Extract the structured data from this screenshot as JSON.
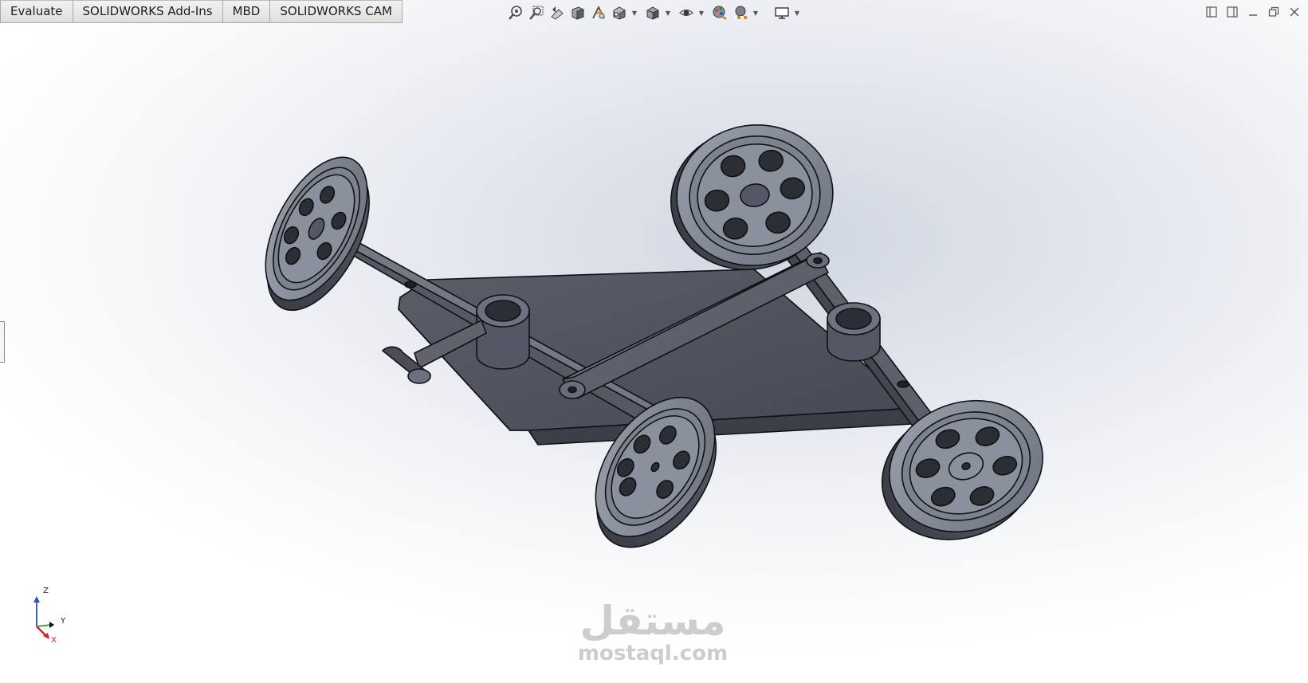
{
  "command_manager": {
    "tabs": [
      {
        "label": "Evaluate"
      },
      {
        "label": "SOLIDWORKS Add-Ins"
      },
      {
        "label": "MBD"
      },
      {
        "label": "SOLIDWORKS CAM"
      }
    ]
  },
  "heads_up_toolbar": {
    "icons": [
      "zoom-to-fit-icon",
      "zoom-to-area-icon",
      "previous-view-icon",
      "section-view-icon",
      "dynamic-annotation-icon",
      "view-orientation-icon",
      "display-style-icon",
      "hide-show-items-icon",
      "edit-appearance-icon",
      "apply-scene-icon",
      "view-settings-icon"
    ]
  },
  "triad": {
    "z_label": "Z",
    "y_label": "Y",
    "x_label": "X",
    "colors": {
      "z": "#2a4fd6",
      "y": "#2e9c3a",
      "x": "#d42020"
    }
  },
  "watermark": {
    "arabic": "مستقل",
    "latin": "mostaql.com"
  },
  "colors": {
    "part_face": "#4f525d",
    "part_light": "#8d92a0",
    "part_edge": "#101114",
    "tab_bg": "#e6e6e6"
  }
}
